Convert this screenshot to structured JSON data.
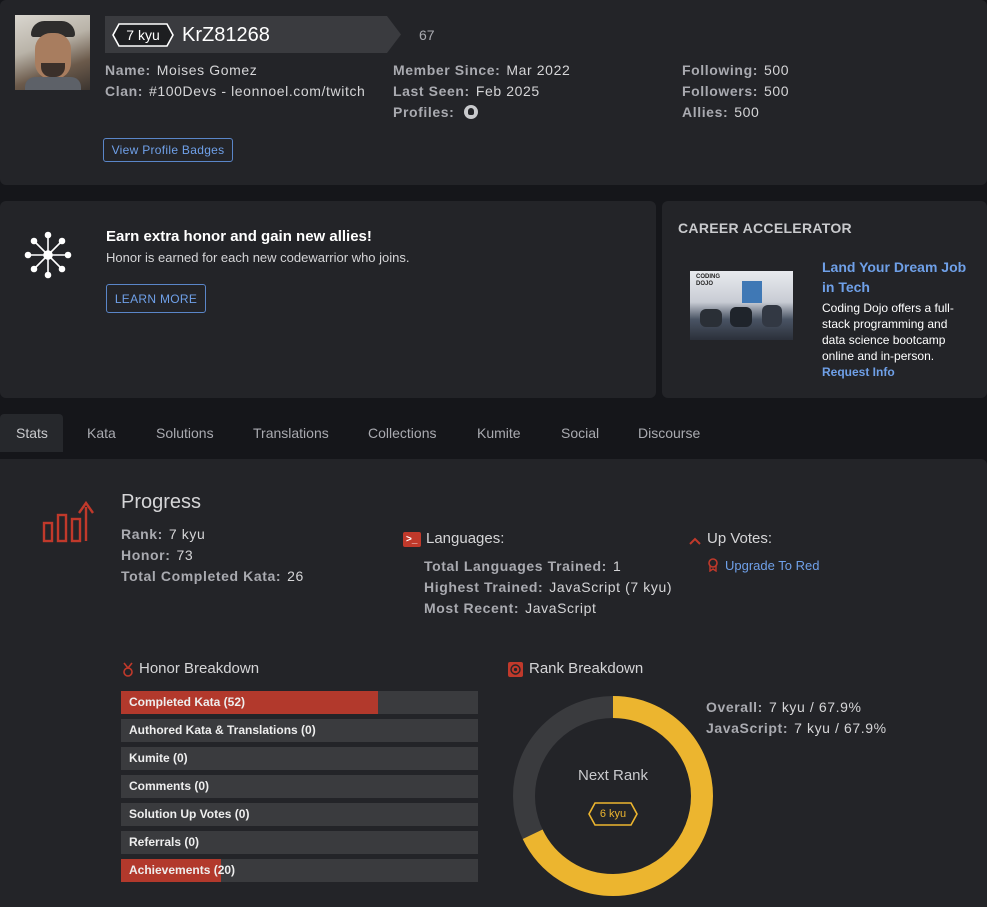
{
  "profile": {
    "rank_badge": "7 kyu",
    "username": "KrZ81268",
    "honor_score": "67",
    "name_label": "Name:",
    "name": "Moises Gomez",
    "clan_label": "Clan:",
    "clan": "#100Devs - leonnoel.com/twitch",
    "member_since_label": "Member Since:",
    "member_since": "Mar 2022",
    "last_seen_label": "Last Seen:",
    "last_seen": "Feb 2025",
    "profiles_label": "Profiles:",
    "following_label": "Following:",
    "following": "500",
    "followers_label": "Followers:",
    "followers": "500",
    "allies_label": "Allies:",
    "allies": "500",
    "badges_button": "View Profile Badges"
  },
  "promo": {
    "title": "Earn extra honor and gain new allies!",
    "text": "Honor is earned for each new codewarrior who joins.",
    "button": "LEARN MORE"
  },
  "career": {
    "heading": "CAREER ACCELERATOR",
    "ad_title": "Land Your Dream Job in Tech",
    "ad_text": "Coding Dojo offers a full-stack programming and data science bootcamp online and in-person.",
    "ad_link": "Request Info",
    "ad_image_label": "CODING DOJO"
  },
  "tabs": [
    "Stats",
    "Kata",
    "Solutions",
    "Translations",
    "Collections",
    "Kumite",
    "Social",
    "Discourse"
  ],
  "progress": {
    "title": "Progress",
    "rank_label": "Rank:",
    "rank": "7 kyu",
    "honor_label": "Honor:",
    "honor": "73",
    "completed_label": "Total Completed Kata:",
    "completed": "26"
  },
  "languages": {
    "title": "Languages:",
    "trained_label": "Total Languages Trained:",
    "trained": "1",
    "highest_label": "Highest Trained:",
    "highest": "JavaScript (7 kyu)",
    "recent_label": "Most Recent:",
    "recent": "JavaScript"
  },
  "upvotes": {
    "title": "Up Votes:",
    "link": "Upgrade To Red"
  },
  "honor_breakdown": {
    "title": "Honor Breakdown",
    "items": [
      {
        "label": "Completed Kata (52)",
        "fraction": 0.72
      },
      {
        "label": "Authored Kata & Translations (0)",
        "fraction": 0
      },
      {
        "label": "Kumite (0)",
        "fraction": 0
      },
      {
        "label": "Comments (0)",
        "fraction": 0
      },
      {
        "label": "Solution Up Votes (0)",
        "fraction": 0
      },
      {
        "label": "Referrals (0)",
        "fraction": 0
      },
      {
        "label": "Achievements (20)",
        "fraction": 0.28
      }
    ]
  },
  "rank_breakdown": {
    "title": "Rank Breakdown",
    "overall_label": "Overall:",
    "overall": "7 kyu / 67.9%",
    "js_label": "JavaScript:",
    "js": "7 kyu / 67.9%",
    "next_rank_label": "Next Rank",
    "next_rank_badge": "6 kyu",
    "progress_percent": 67.9
  },
  "colors": {
    "accent_red": "#b2392c",
    "progress_gold": "#ecb52f",
    "link_blue": "#6fa0e8"
  }
}
